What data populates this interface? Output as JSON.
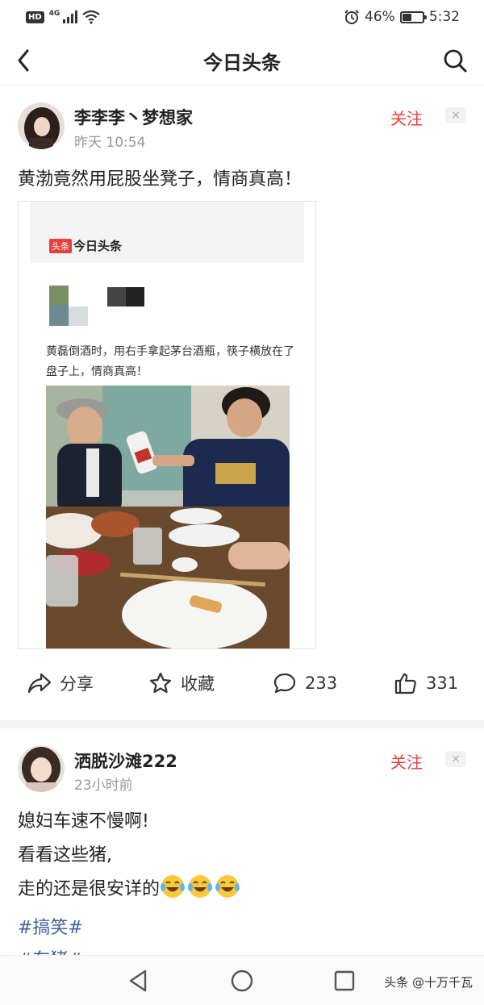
{
  "status_bar": {
    "hd": "HD",
    "network": "4G",
    "battery_text": "46%",
    "battery_level": 0.46,
    "time": "5:32"
  },
  "header": {
    "title": "今日头条"
  },
  "posts": [
    {
      "author": "李李李丶梦想家",
      "time": "昨天  10:54",
      "follow": "关注",
      "dismiss": "×",
      "text": "黄渤竟然用屁股坐凳子，情商真高！",
      "embed": {
        "badge": "头条",
        "brand": "今日头条",
        "caption": "黄磊倒酒时，用右手拿起茅台酒瓶，筷子横放在了盘子上，情商真高！"
      },
      "actions": {
        "share": "分享",
        "favorite": "收藏",
        "comments": "233",
        "likes": "331"
      }
    },
    {
      "author": "洒脱沙滩222",
      "time": "23小时前",
      "follow": "关注",
      "dismiss": "×",
      "lines": [
        "媳妇车速不慢啊!",
        "看看这些猪,",
        "走的还是很安详的"
      ],
      "hashtag": "#搞笑#",
      "hashtag2": "#车猪#"
    }
  ],
  "watermark": "头条 @十万千瓦",
  "icons": {
    "back": "chevron-left-icon",
    "search": "search-icon",
    "share": "share-icon",
    "favorite": "star-icon",
    "comment": "comment-icon",
    "like": "thumbs-up-icon",
    "emoji": "tears-of-joy-emoji"
  }
}
